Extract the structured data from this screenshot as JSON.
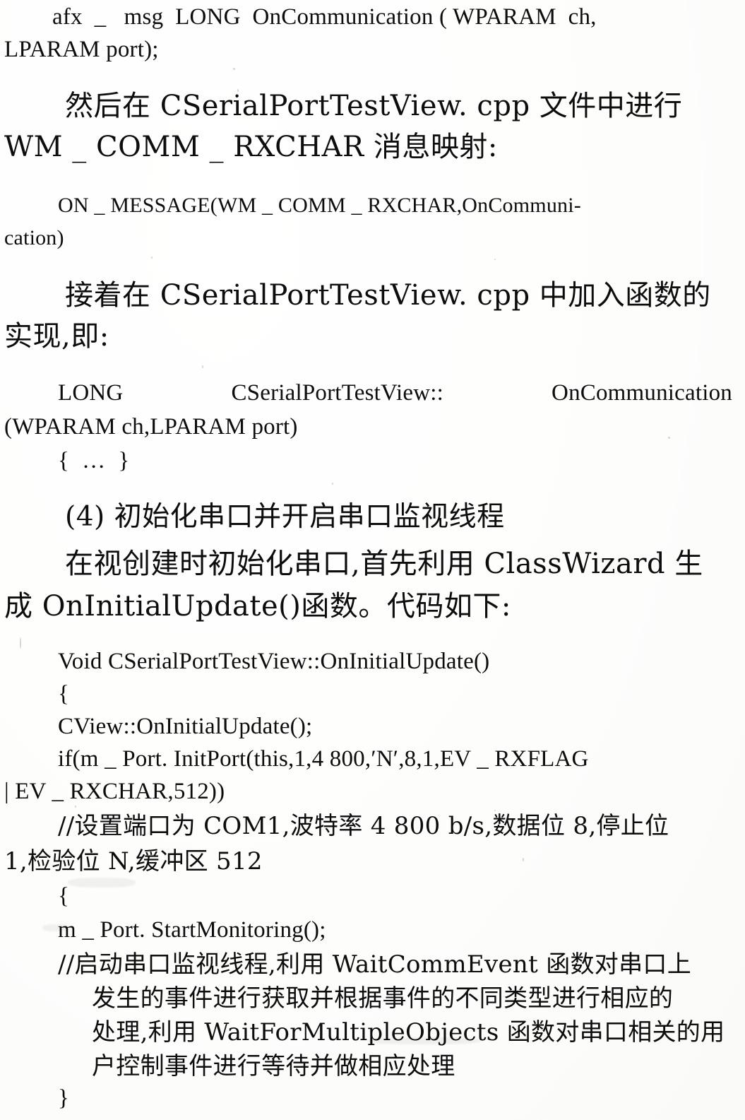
{
  "document": {
    "type": "scanned-book-page",
    "language": "zh-CN",
    "subject": "MFC serial port programming tutorial"
  },
  "lines": {
    "l01": "afx  _   msg  LONG  OnCommunication ( WPARAM  ch,",
    "l02": "LPARAM port);",
    "l03": "然后在 CSerialPortTestView. cpp 文件中进行",
    "l04": "WM _ COMM _ RXCHAR 消息映射:",
    "l05": "ON _ MESSAGE(WM _ COMM _ RXCHAR,OnCommuni-",
    "l06": "cation)",
    "l07": "接着在 CSerialPortTestView. cpp 中加入函数的",
    "l08": "实现,即:",
    "l09a": "LONG",
    "l09b": "CSerialPortTestView::",
    "l09c": "OnCommunication",
    "l10": "(WPARAM ch,LPARAM port)",
    "l11": "{ … }",
    "l12": "(4) 初始化串口并开启串口监视线程",
    "l13": "在视创建时初始化串口,首先利用 ClassWizard 生",
    "l14": "成 OnInitialUpdate()函数。代码如下:",
    "l15": "Void CSerialPortTestView::OnInitialUpdate()",
    "l16": "{",
    "l17": "CView::OnInitialUpdate();",
    "l18": "if(m _ Port. InitPort(this,1,4 800,′N′,8,1,EV _ RXFLAG",
    "l19": "| EV _ RXCHAR,512))",
    "l20": "//设置端口为 COM1,波特率 4 800 b/s,数据位 8,停止位",
    "l21": "1,检验位 N,缓冲区 512",
    "l22": "{",
    "l23": "m _ Port. StartMonitoring();",
    "l24": "//启动串口监视线程,利用 WaitCommEvent 函数对串口上",
    "l25": "发生的事件进行获取并根据事件的不同类型进行相应的",
    "l26": "处理,利用 WaitForMultipleObjects 函数对串口相关的用",
    "l27": "户控制事件进行等待并做相应处理",
    "l28": "}"
  }
}
